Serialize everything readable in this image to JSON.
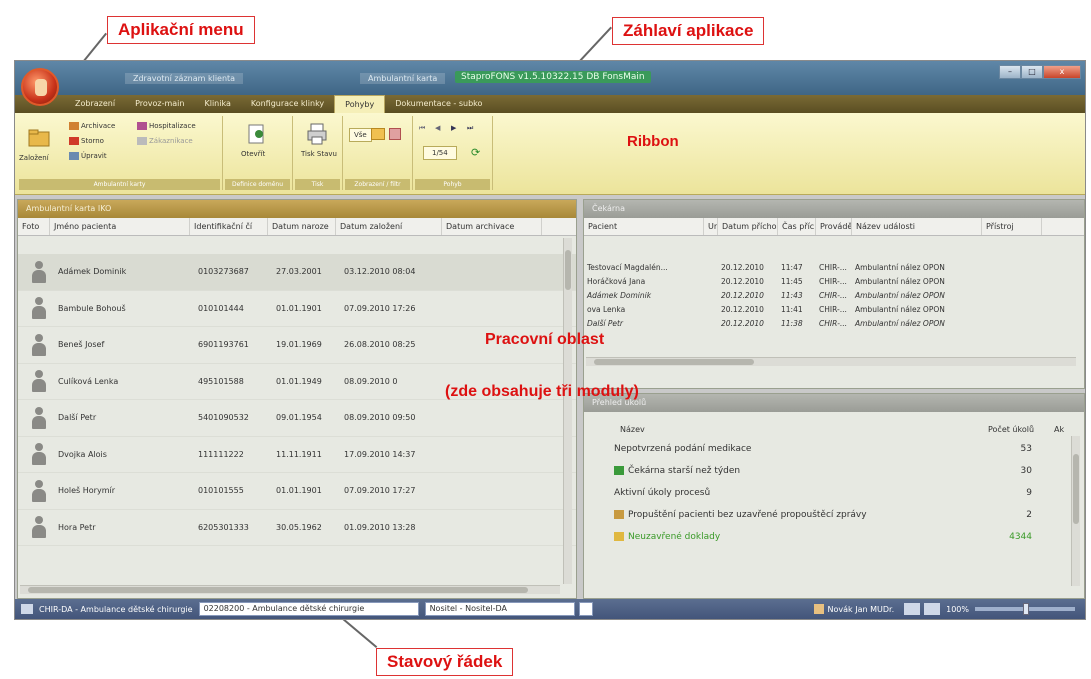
{
  "callouts": {
    "app_menu": "Aplikační menu",
    "app_header": "Záhlaví aplikace",
    "ribbon": "Ribbon",
    "work_area": "Pracovní oblast",
    "work_area_note": "(zde obsahuje tři moduly)",
    "status_bar": "Stavový řádek"
  },
  "window": {
    "title": "StaproFONS v1.5.10322.15 DB FonsMain",
    "title_tabs": [
      "Zdravotní záznam klienta",
      "Ambulantní karta"
    ],
    "buttons": {
      "minimize": "–",
      "maximize": "□",
      "close": "x"
    }
  },
  "ribbon_tabs": [
    "Zobrazení",
    "Provoz-main",
    "Klinika",
    "Konfigurace klinky",
    "Pohyby",
    "Dokumentace - subko"
  ],
  "active_tab_index": 4,
  "ribbon": {
    "groups": [
      {
        "label": "Ambulantní karty",
        "big": "Založení",
        "small": [
          "Archivace",
          "Storno",
          "Úpravit",
          "Hospitalizace",
          "Zákazníkace"
        ]
      },
      {
        "label": "Definice doměnu",
        "big": "Otevřít"
      },
      {
        "label": "Tisk",
        "big": "Tisk Stavu"
      },
      {
        "label": "Zobrazení / filtr",
        "big": "Vše"
      },
      {
        "label": "Pohyb",
        "pager": "1/54"
      }
    ]
  },
  "ambulance_panel": {
    "title": "Ambulantní karta IKO",
    "columns": [
      "Foto",
      "Jméno pacienta",
      "Identifikační čí",
      "Datum naroze",
      "Datum založení",
      "Datum archivace"
    ],
    "rows": [
      {
        "name": "Adámek Dominik",
        "id": "0103273687",
        "birth": "27.03.2001",
        "created": "03.12.2010 08:04",
        "archived": ""
      },
      {
        "name": "Bambule Bohouš",
        "id": "010101444",
        "birth": "01.01.1901",
        "created": "07.09.2010 17:26",
        "archived": ""
      },
      {
        "name": "Beneš Josef",
        "id": "6901193761",
        "birth": "19.01.1969",
        "created": "26.08.2010 08:25",
        "archived": ""
      },
      {
        "name": "Culíková Lenka",
        "id": "495101588",
        "birth": "01.01.1949",
        "created": "08.09.2010 0",
        "archived": ""
      },
      {
        "name": "Další Petr",
        "id": "5401090532",
        "birth": "09.01.1954",
        "created": "08.09.2010 09:50",
        "archived": ""
      },
      {
        "name": "Dvojka Alois",
        "id": "111111222",
        "birth": "11.11.1911",
        "created": "17.09.2010 14:37",
        "archived": ""
      },
      {
        "name": "Holeš Horymír",
        "id": "010101555",
        "birth": "01.01.1901",
        "created": "07.09.2010 17:27",
        "archived": ""
      },
      {
        "name": "Hora Petr",
        "id": "6205301333",
        "birth": "30.05.1962",
        "created": "01.09.2010 13:28",
        "archived": ""
      }
    ]
  },
  "queue_panel": {
    "title": "Čekárna",
    "columns": [
      "Pacient",
      "Ur",
      "Datum přícho",
      "Čas příc",
      "Prováděj",
      "Název události",
      "Přístroj"
    ],
    "rows": [
      {
        "patient": "Testovací Magdalén...",
        "date": "20.12.2010",
        "time": "11:47",
        "performer": "CHIR-...",
        "event": "Ambulantní nález OPON",
        "italic": false
      },
      {
        "patient": "Horáčková Jana",
        "date": "20.12.2010",
        "time": "11:45",
        "performer": "CHIR-...",
        "event": "Ambulantní nález OPON",
        "italic": false
      },
      {
        "patient": "Adámek Dominik",
        "date": "20.12.2010",
        "time": "11:43",
        "performer": "CHIR-...",
        "event": "Ambulantní nález OPON",
        "italic": true
      },
      {
        "patient": "ova Lenka",
        "date": "20.12.2010",
        "time": "11:41",
        "performer": "CHIR-...",
        "event": "Ambulantní nález OPON",
        "italic": false
      },
      {
        "patient": "Další Petr",
        "date": "20.12.2010",
        "time": "11:38",
        "performer": "CHIR-...",
        "event": "Ambulantní nález OPON",
        "italic": true
      }
    ]
  },
  "tasks_panel": {
    "title": "Přehled úkolů",
    "columns": [
      "Název",
      "Počet úkolů",
      "Ak"
    ],
    "rows": [
      {
        "name": "Nepotvrzená podání medikace",
        "count": "53",
        "icon": "",
        "green": false
      },
      {
        "name": "Čekárna starší než týden",
        "count": "30",
        "icon": "sofa-icon",
        "green": false
      },
      {
        "name": "Aktivní úkoly procesů",
        "count": "9",
        "icon": "",
        "green": false
      },
      {
        "name": "Propuštění pacienti bez uzavřené propouštěcí zprávy",
        "count": "2",
        "icon": "person-icon",
        "green": false
      },
      {
        "name": "Neuzavřené doklady",
        "count": "4344",
        "icon": "pencil-icon",
        "green": true
      }
    ]
  },
  "status_bar": {
    "department": "CHIR-DA - Ambulance dětské chirurgie",
    "workplace": "02208200 - Ambulance dětské chirurgie",
    "carrier": "Nositel - Nositel-DA",
    "user": "Novák Jan MUDr.",
    "zoom": "100%"
  },
  "colors": {
    "callout_red": "#dd1111",
    "panel_gold": "#b89840",
    "ribbon_yellow": "#f5efb8",
    "status_blue": "#4a5d85",
    "tasks_green": "#3a9a28"
  }
}
